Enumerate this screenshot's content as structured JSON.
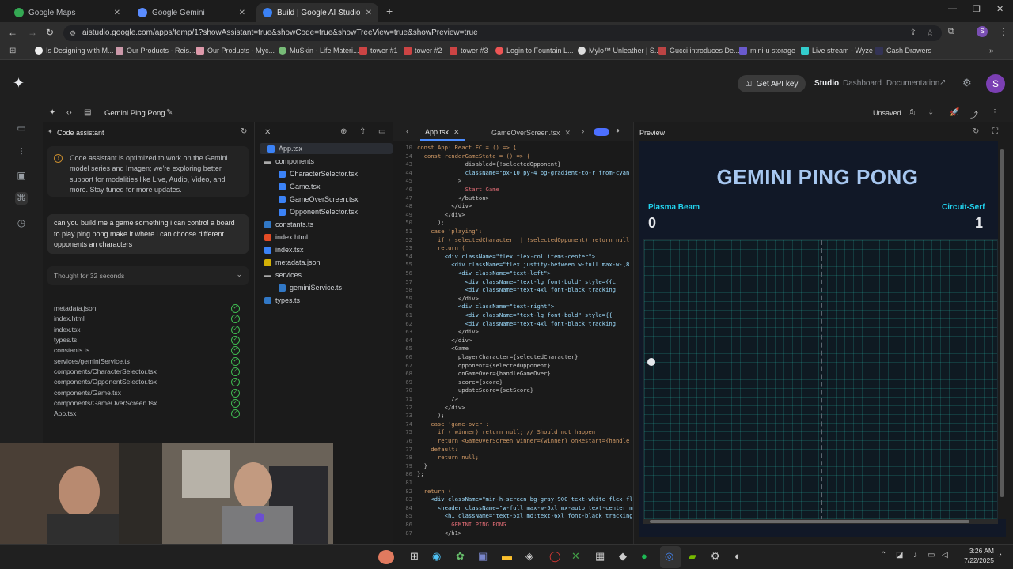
{
  "browser": {
    "tabs": [
      {
        "title": "Google Maps"
      },
      {
        "title": "Google Gemini"
      },
      {
        "title": "Build | Google AI Studio"
      }
    ],
    "url": "aistudio.google.com/apps/temp/1?showAssistant=true&showCode=true&showTreeView=true&showPreview=true",
    "bookmarks": [
      "Is Designing with M...",
      "Our Products - Reis...",
      "Our Products - Myc...",
      "MuSkin - Life Materi...",
      "tower #1",
      "tower #2",
      "tower #3",
      "Login to Fountain L...",
      "Mylo™ Unleather | S...",
      "Gucci introduces De...",
      "mini-u storage",
      "Live stream - Wyze",
      "Cash Drawers"
    ]
  },
  "header": {
    "api_key": "Get API key",
    "nav": [
      "Studio",
      "Dashboard",
      "Documentation"
    ],
    "avatar": "S"
  },
  "project": {
    "name": "Gemini Ping Pong",
    "status": "Unsaved"
  },
  "assistant": {
    "title": "Code assistant",
    "notice": "Code assistant is optimized to work on the Gemini model series and Imagen; we're exploring better support for modalities like Live, Audio, Video, and more. Stay tuned for more updates.",
    "prompt": "can you build me a game something i can control a board to play ping pong make it where i can choose different opponents an characters",
    "thought": "Thought for 32 seconds",
    "generated_files": [
      "metadata.json",
      "index.html",
      "index.tsx",
      "types.ts",
      "constants.ts",
      "services/geminiService.ts",
      "components/CharacterSelector.tsx",
      "components/OpponentSelector.tsx",
      "components/Game.tsx",
      "components/GameOverScreen.tsx",
      "App.tsx"
    ]
  },
  "filetree": {
    "items": [
      {
        "name": "App.tsx",
        "type": "file"
      },
      {
        "name": "components",
        "type": "folder"
      },
      {
        "name": "CharacterSelector.tsx",
        "type": "file"
      },
      {
        "name": "Game.tsx",
        "type": "file"
      },
      {
        "name": "GameOverScreen.tsx",
        "type": "file"
      },
      {
        "name": "OpponentSelector.tsx",
        "type": "file"
      },
      {
        "name": "constants.ts",
        "type": "file"
      },
      {
        "name": "index.html",
        "type": "file"
      },
      {
        "name": "index.tsx",
        "type": "file"
      },
      {
        "name": "metadata.json",
        "type": "file"
      },
      {
        "name": "services",
        "type": "folder"
      },
      {
        "name": "geminiService.ts",
        "type": "file"
      },
      {
        "name": "types.ts",
        "type": "file"
      }
    ]
  },
  "editor": {
    "tabs": [
      "App.tsx",
      "GameOverScreen.tsx"
    ],
    "lines": [
      {
        "n": "10",
        "t": "const App: React.FC = () => {"
      },
      {
        "n": "34",
        "t": "  const renderGameState = () => {"
      },
      {
        "n": "43",
        "t": "              disabled={!selectedOpponent}"
      },
      {
        "n": "44",
        "t": "              className=\"px-10 py-4 bg-gradient-to-r from-cyan"
      },
      {
        "n": "45",
        "t": "            >"
      },
      {
        "n": "46",
        "t": "              Start Game"
      },
      {
        "n": "47",
        "t": "            </button>"
      },
      {
        "n": "48",
        "t": "          </div>"
      },
      {
        "n": "49",
        "t": "        </div>"
      },
      {
        "n": "50",
        "t": "      );"
      },
      {
        "n": "51",
        "t": "    case 'playing':"
      },
      {
        "n": "52",
        "t": "      if (!selectedCharacter || !selectedOpponent) return null"
      },
      {
        "n": "53",
        "t": "      return ("
      },
      {
        "n": "54",
        "t": "        <div className=\"flex flex-col items-center\">"
      },
      {
        "n": "55",
        "t": "          <div className=\"flex justify-between w-full max-w-[8"
      },
      {
        "n": "56",
        "t": "            <div className=\"text-left\">"
      },
      {
        "n": "57",
        "t": "              <div className=\"text-lg font-bold\" style={{c"
      },
      {
        "n": "58",
        "t": "              <div className=\"text-4xl font-black tracking"
      },
      {
        "n": "59",
        "t": "            </div>"
      },
      {
        "n": "60",
        "t": "            <div className=\"text-right\">"
      },
      {
        "n": "61",
        "t": "              <div className=\"text-lg font-bold\" style={{"
      },
      {
        "n": "62",
        "t": "              <div className=\"text-4xl font-black tracking"
      },
      {
        "n": "63",
        "t": "            </div>"
      },
      {
        "n": "64",
        "t": "          </div>"
      },
      {
        "n": "65",
        "t": "          <Game"
      },
      {
        "n": "66",
        "t": "            playerCharacter={selectedCharacter}"
      },
      {
        "n": "67",
        "t": "            opponent={selectedOpponent}"
      },
      {
        "n": "68",
        "t": "            onGameOver={handleGameOver}"
      },
      {
        "n": "69",
        "t": "            score={score}"
      },
      {
        "n": "70",
        "t": "            updateScore={setScore}"
      },
      {
        "n": "71",
        "t": "          />"
      },
      {
        "n": "72",
        "t": "        </div>"
      },
      {
        "n": "73",
        "t": "      );"
      },
      {
        "n": "74",
        "t": "    case 'game-over':"
      },
      {
        "n": "75",
        "t": "      if (!winner) return null; // Should not happen"
      },
      {
        "n": "76",
        "t": "      return <GameOverScreen winner={winner} onRestart={handle"
      },
      {
        "n": "77",
        "t": "    default:"
      },
      {
        "n": "78",
        "t": "      return null;"
      },
      {
        "n": "79",
        "t": "  }"
      },
      {
        "n": "80",
        "t": "};"
      },
      {
        "n": "81",
        "t": ""
      },
      {
        "n": "82",
        "t": "  return ("
      },
      {
        "n": "83",
        "t": "    <div className=\"min-h-screen bg-gray-900 text-white flex fl"
      },
      {
        "n": "84",
        "t": "      <header className=\"w-full max-w-5xl mx-auto text-center m"
      },
      {
        "n": "85",
        "t": "        <h1 className=\"text-5xl md:text-6xl font-black tracking-"
      },
      {
        "n": "86",
        "t": "          GEMINI PING PONG"
      },
      {
        "n": "87",
        "t": "        </h1>"
      }
    ]
  },
  "preview": {
    "label": "Preview",
    "game_title": "GEMINI PING PONG",
    "player_name": "Plasma Beam",
    "player_score": "0",
    "opponent_name": "Circuit-Serf",
    "opponent_score": "1"
  },
  "taskbar": {
    "time": "3:26 AM",
    "date": "7/22/2025"
  }
}
